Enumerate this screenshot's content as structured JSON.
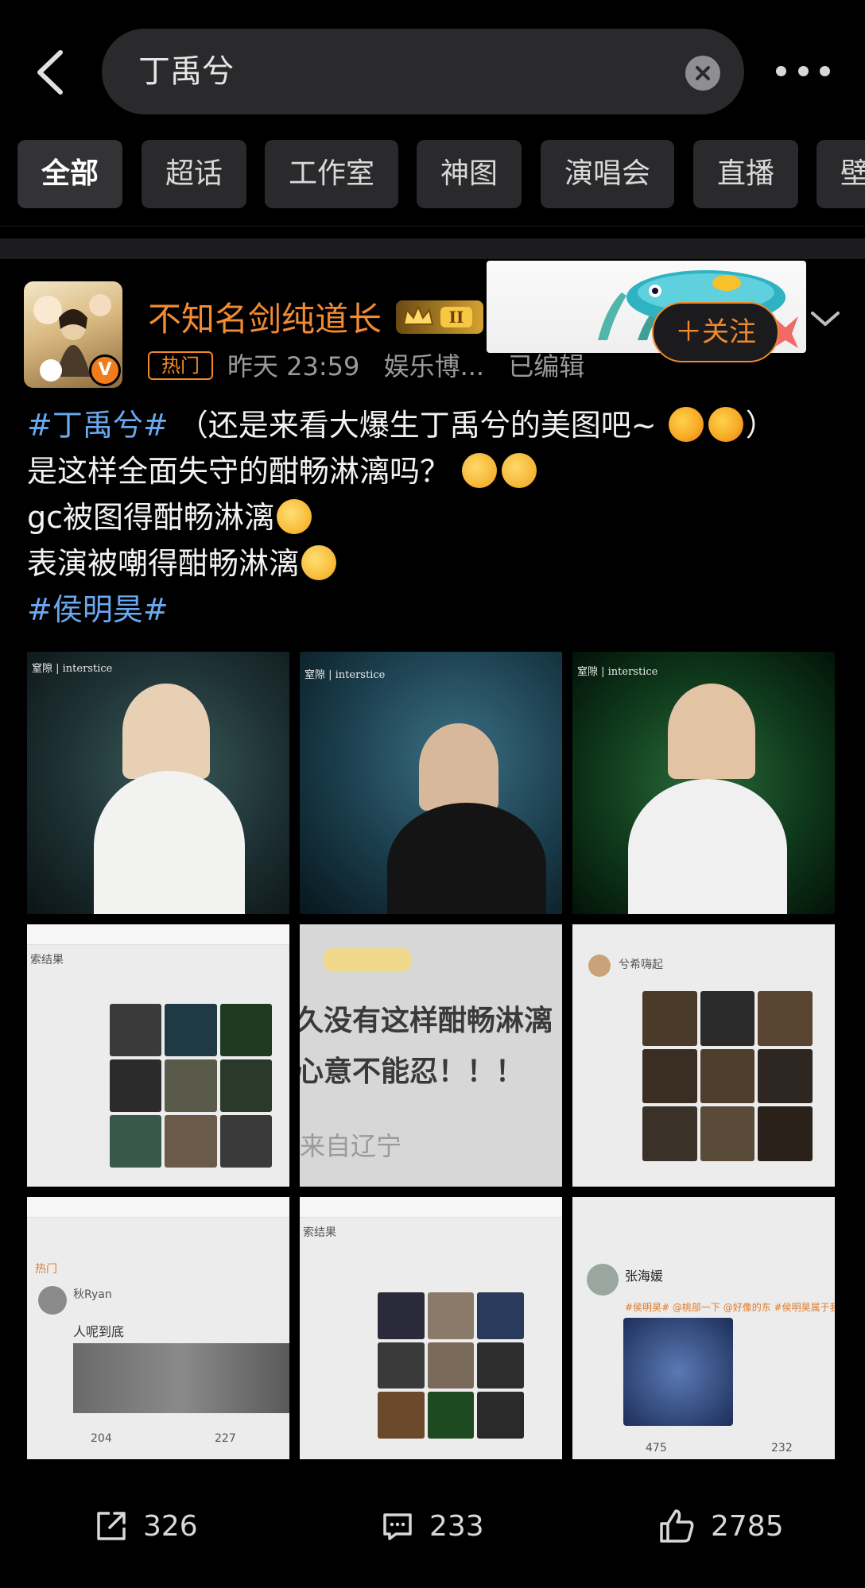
{
  "search": {
    "query": "丁禹兮"
  },
  "tabs": [
    "全部",
    "超话",
    "工作室",
    "神图",
    "演唱会",
    "直播",
    "壁"
  ],
  "post": {
    "username": "不知名剑纯道长",
    "follow_label": "＋关注",
    "hot_tag": "热门",
    "time": "昨天 23:59",
    "source": "娱乐博...",
    "edited": "已编辑",
    "avatar_badge": "V",
    "content": {
      "line1_hashtag": "#丁禹兮#",
      "line1_text": "（还是来看大爆生丁禹兮的美图吧~",
      "line1_end": "）",
      "line2_text": "是这样全面失守的酣畅淋漓吗？",
      "line3_text": "gc被图得酣畅淋漓",
      "line4_text": "表演被嘲得酣畅淋漓",
      "line5_hashtag": "#侯明昊#"
    },
    "images": [
      {
        "caption": "窒隙 | interstice"
      },
      {
        "caption": "窒隙 | interstice"
      },
      {
        "caption": "窒隙 | interstice"
      },
      {
        "screenshot_label": "索结果"
      },
      {
        "line1": "久没有这样酣畅淋漓",
        "line2": "心意不能忍！！！",
        "line3": "来自辽宁"
      },
      {
        "name": "兮希嗨起"
      },
      {
        "hot": "热门",
        "name": "秋Ryan",
        "text": "人呢到底",
        "repost": "204",
        "comment": "227"
      },
      {
        "screenshot_label": "索结果"
      },
      {
        "name": "张海媛",
        "hashtags": "#侯明昊# @桃部一下 @好像的东 #侯明昊属于我",
        "repost": "475",
        "comment": "232"
      }
    ],
    "stats": {
      "reposts": "326",
      "comments": "233",
      "likes": "2785"
    }
  },
  "colors": {
    "accent": "#f28a30",
    "hashtag": "#6aa9f0",
    "background": "#000000"
  }
}
